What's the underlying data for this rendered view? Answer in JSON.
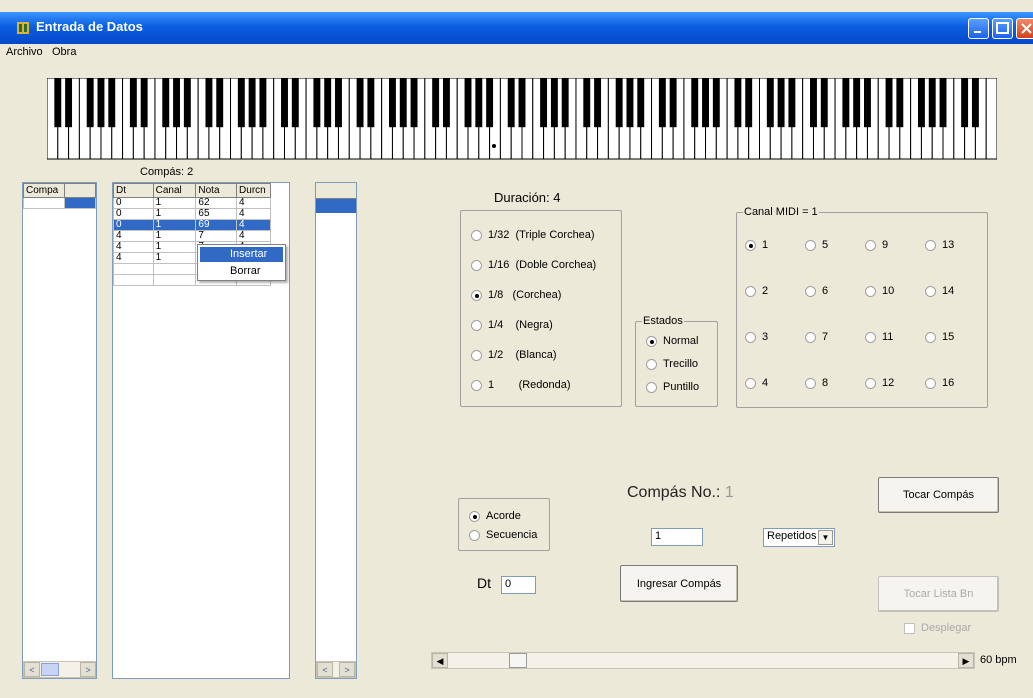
{
  "window": {
    "title": "Entrada de Datos"
  },
  "menu": [
    "Archivo",
    "Obra"
  ],
  "compas_header": "Compás: 2",
  "left_list": {
    "header": "Compa"
  },
  "note_table": {
    "columns": [
      "Dt",
      "Canal",
      "Nota",
      "Durcn"
    ],
    "rows": [
      [
        "0",
        "1",
        "62",
        "4"
      ],
      [
        "0",
        "1",
        "65",
        "4"
      ],
      [
        "0",
        "1",
        "69",
        "4"
      ],
      [
        "4",
        "1",
        "7",
        "4"
      ],
      [
        "4",
        "1",
        "7",
        "4"
      ],
      [
        "4",
        "1",
        "81",
        "4"
      ]
    ],
    "selected_row": 2
  },
  "context_menu": {
    "items": [
      "Insertar",
      "Borrar"
    ]
  },
  "duracion": {
    "label": "Duración:",
    "value": "4",
    "options": [
      {
        "label": "1/32  (Triple Corchea)",
        "checked": false
      },
      {
        "label": "1/16  (Doble Corchea)",
        "checked": false
      },
      {
        "label": "1/8   (Corchea)",
        "checked": true
      },
      {
        "label": "1/4    (Negra)",
        "checked": false
      },
      {
        "label": "1/2    (Blanca)",
        "checked": false
      },
      {
        "label": "1        (Redonda)",
        "checked": false
      }
    ]
  },
  "estados": {
    "label": "Estados",
    "options": [
      {
        "label": "Normal",
        "checked": true
      },
      {
        "label": "Trecillo",
        "checked": false
      },
      {
        "label": "Puntillo",
        "checked": false
      }
    ]
  },
  "canal_midi": {
    "label": "Canal MIDI = 1",
    "options": [
      "1",
      "5",
      "9",
      "13",
      "2",
      "6",
      "10",
      "14",
      "3",
      "7",
      "11",
      "15",
      "4",
      "8",
      "12",
      "16"
    ],
    "checked": "1"
  },
  "modo": {
    "options": [
      {
        "label": "Acorde",
        "checked": true
      },
      {
        "label": "Secuencia",
        "checked": false
      }
    ]
  },
  "compas_no": {
    "label": "Compás No.:",
    "value": "1",
    "input": "1"
  },
  "repetidos": {
    "value": "Repetidos"
  },
  "dt": {
    "label": "Dt",
    "value": "0"
  },
  "buttons": {
    "tocar_compas": "Tocar Compás",
    "ingresar_compas": "Ingresar Compás",
    "tocar_lista": "Tocar Lista Bn"
  },
  "desplegar": {
    "label": "Desplegar",
    "checked": false
  },
  "tempo": {
    "label": "60 bpm",
    "value": 60
  }
}
